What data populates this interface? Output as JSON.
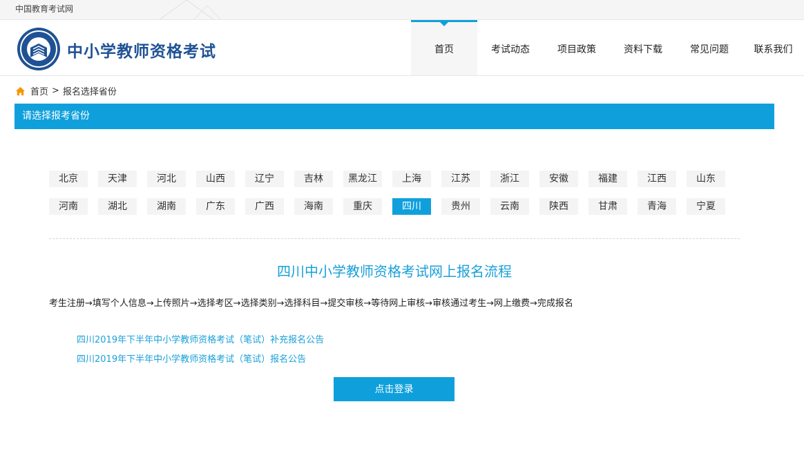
{
  "topbar": {
    "site_name": "中国教育考试网"
  },
  "header": {
    "title": "中小学教师资格考试"
  },
  "nav": {
    "items": [
      "首页",
      "考试动态",
      "项目政策",
      "资料下载",
      "常见问题",
      "联系我们"
    ],
    "active": "首页"
  },
  "breadcrumb": {
    "home": "首页",
    "separator": ">",
    "current": "报名选择省份"
  },
  "section": {
    "title": "请选择报考省份"
  },
  "provinces": {
    "row1": [
      "北京",
      "天津",
      "河北",
      "山西",
      "辽宁",
      "吉林",
      "黑龙江",
      "上海",
      "江苏",
      "浙江",
      "安徽",
      "福建",
      "江西",
      "山东"
    ],
    "row2": [
      "河南",
      "湖北",
      "湖南",
      "广东",
      "广西",
      "海南",
      "重庆",
      "四川",
      "贵州",
      "云南",
      "陕西",
      "甘肃",
      "青海",
      "宁夏"
    ],
    "selected": "四川"
  },
  "flow": {
    "title": "四川中小学教师资格考试网上报名流程",
    "steps": "考生注册→填写个人信息→上传照片→选择考区→选择类别→选择科目→提交审核→等待网上审核→审核通过考生→网上缴费→完成报名"
  },
  "notices": [
    "四川2019年下半年中小学教师资格考试（笔试）补充报名公告",
    "四川2019年下半年中小学教师资格考试（笔试）报名公告"
  ],
  "login": {
    "label": "点击登录"
  },
  "colors": {
    "accent": "#0fa0dc",
    "brand": "#1f5294",
    "link": "#1aa0d8",
    "home_icon": "#f39800"
  },
  "icons": {
    "home": "home-icon",
    "logo": "emblem-logo"
  }
}
